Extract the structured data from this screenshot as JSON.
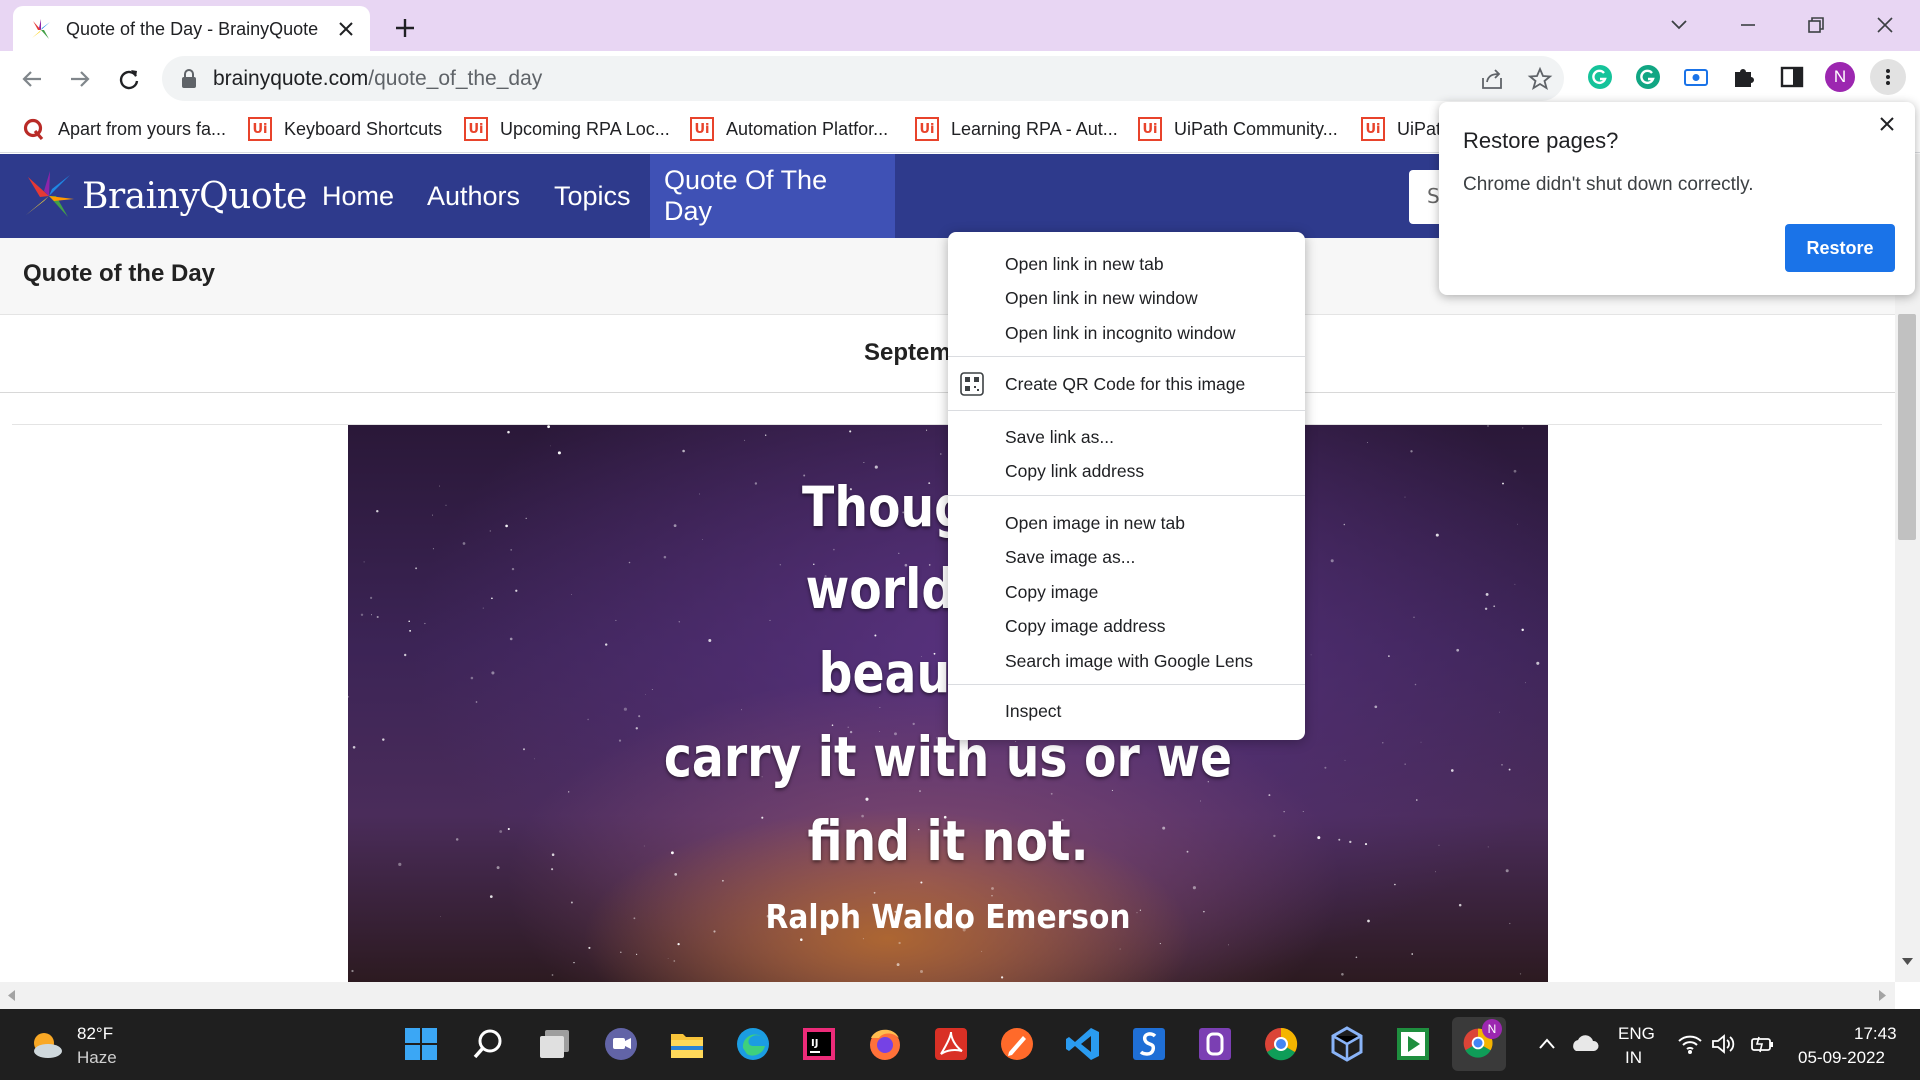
{
  "browser": {
    "tab": {
      "title": "Quote of the Day - BrainyQuote"
    },
    "url": {
      "domain": "brainyquote.com",
      "path": "/quote_of_the_day"
    },
    "bookmarks": [
      {
        "label": "Apart from yours fa...",
        "icon": "quora-icon"
      },
      {
        "label": "Keyboard Shortcuts",
        "icon": "uipath-icon"
      },
      {
        "label": "Upcoming RPA Loc...",
        "icon": "uipath-icon"
      },
      {
        "label": "Automation Platfor...",
        "icon": "uipath-icon"
      },
      {
        "label": "Learning RPA - Aut...",
        "icon": "uipath-icon"
      },
      {
        "label": "UiPath Community...",
        "icon": "uipath-icon"
      },
      {
        "label": "UiPat",
        "icon": "uipath-icon"
      }
    ],
    "profile_initial": "N",
    "uipath_icon_text": "Ui"
  },
  "site": {
    "logo_text": "BrainyQuote",
    "nav": [
      "Home",
      "Authors",
      "Topics",
      "Quote Of The Day"
    ],
    "search_placeholder_visible": "S",
    "section_title": "Quote of the Day",
    "date_visible": "Septem",
    "quote_lines": [
      "Though we",
      "world over",
      "beautiful,",
      "carry it with us or we",
      "find it not."
    ],
    "quote_author": "Ralph Waldo Emerson"
  },
  "context_menu": {
    "groups": [
      [
        "Open link in new tab",
        "Open link in new window",
        "Open link in incognito window"
      ],
      [
        "Create QR Code for this image"
      ],
      [
        "Save link as...",
        "Copy link address"
      ],
      [
        "Open image in new tab",
        "Save image as...",
        "Copy image",
        "Copy image address",
        "Search image with Google Lens"
      ],
      [
        "Inspect"
      ]
    ]
  },
  "restore_popup": {
    "title": "Restore pages?",
    "message": "Chrome didn't shut down correctly.",
    "button": "Restore"
  },
  "taskbar": {
    "weather": {
      "temp": "82°F",
      "condition": "Haze"
    },
    "language": [
      "ENG",
      "IN"
    ],
    "time": "17:43",
    "date": "05-09-2022",
    "chrome_badge": "N"
  },
  "colors": {
    "tabstrip": "#e8d6f3",
    "site_header": "#2e3a8c",
    "nav_active": "#3f51b5",
    "accent_blue": "#1a73e8"
  }
}
